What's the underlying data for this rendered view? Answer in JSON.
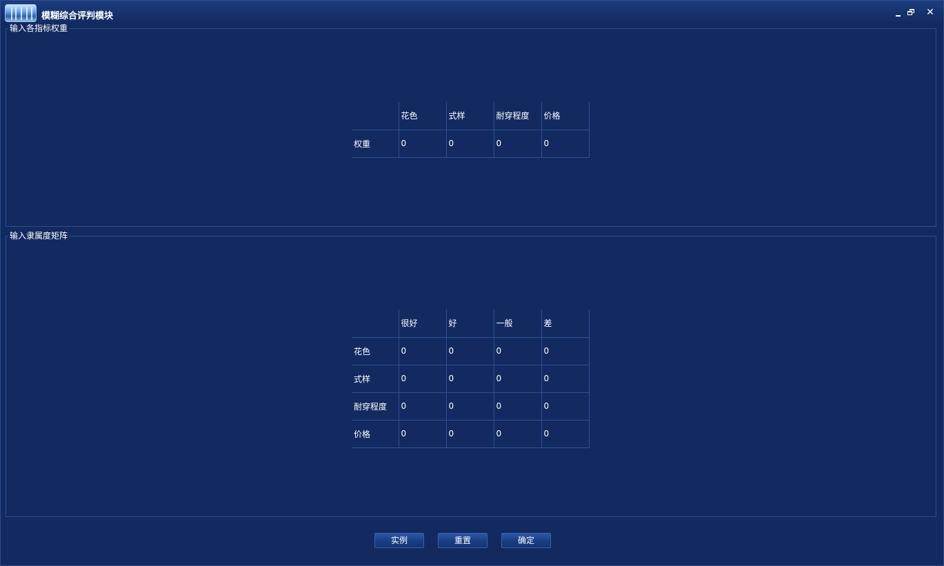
{
  "window": {
    "title": "模糊综合评判模块"
  },
  "icons": {
    "minimize": "minimize-icon",
    "restore": "restore-icon",
    "close": "close-icon",
    "close_glyph": "✕"
  },
  "weights_group": {
    "legend": "输入各指标权重",
    "header": [
      "",
      "花色",
      "式样",
      "耐穿程度",
      "价格"
    ],
    "rows": [
      {
        "label": "权重",
        "values": [
          "0",
          "0",
          "0",
          "0"
        ]
      }
    ]
  },
  "membership_group": {
    "legend": "输入隶属度矩阵",
    "header": [
      "",
      "很好",
      "好",
      "一般",
      "差"
    ],
    "rows": [
      {
        "label": "花色",
        "values": [
          "0",
          "0",
          "0",
          "0"
        ]
      },
      {
        "label": "式样",
        "values": [
          "0",
          "0",
          "0",
          "0"
        ]
      },
      {
        "label": "耐穿程度",
        "values": [
          "0",
          "0",
          "0",
          "0"
        ]
      },
      {
        "label": "价格",
        "values": [
          "0",
          "0",
          "0",
          "0"
        ]
      }
    ]
  },
  "buttons": {
    "example": "实例",
    "reset": "重置",
    "confirm": "确定"
  },
  "colors": {
    "background": "#122a60",
    "titlebar": "#173470",
    "grid_line": "#2d5296",
    "text": "#ffffff"
  }
}
